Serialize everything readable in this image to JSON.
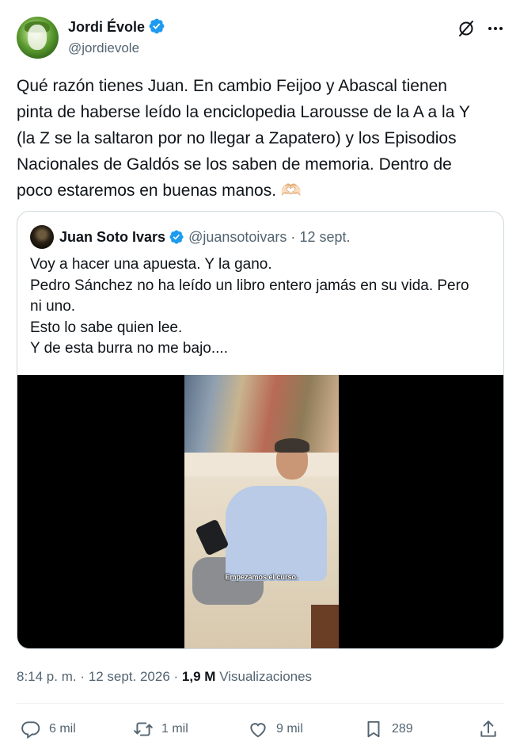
{
  "author": {
    "name": "Jordi Évole",
    "handle": "@jordievole"
  },
  "tweet": {
    "lines": [
      "Qué razón tienes Juan. En cambio Feijoo y Abascal tienen",
      "pinta de haberse leído la enciclopedia Larousse de la A a la Y",
      "(la Z se la saltaron por no llegar a Zapatero) y los Episodios",
      "Nacionales de Galdós se los saben de memoria. Dentro de",
      "poco estaremos en buenas manos. 🫶🏻"
    ]
  },
  "quote": {
    "name": "Juan Soto Ivars",
    "handle": "@juansotoivars",
    "separator": "·",
    "date": "12 sept.",
    "lines": [
      "Voy a hacer una apuesta. Y la gano.",
      "Pedro Sánchez no ha leído un libro entero jamás en su vida. Pero",
      "ni uno.",
      "Esto lo sabe quien lee.",
      "Y de esta burra no me bajo...."
    ],
    "video_caption": "Empezamos el curso."
  },
  "meta": {
    "time": "8:14 p. m.",
    "separator": "·",
    "date": "12 sept. 2026",
    "separator2": "·",
    "views_count": "1,9 M",
    "views_label": "Visualizaciones"
  },
  "actions": {
    "replies": "6 mil",
    "retweets": "1 mil",
    "likes": "9 mil",
    "bookmarks": "289"
  },
  "colors": {
    "verified": "#1d9bf0",
    "muted": "#536471",
    "text": "#0f1419"
  },
  "icons": [
    "verified-badge-icon",
    "grok-icon",
    "more-icon",
    "reply-icon",
    "retweet-icon",
    "like-icon",
    "bookmark-icon",
    "share-icon"
  ]
}
